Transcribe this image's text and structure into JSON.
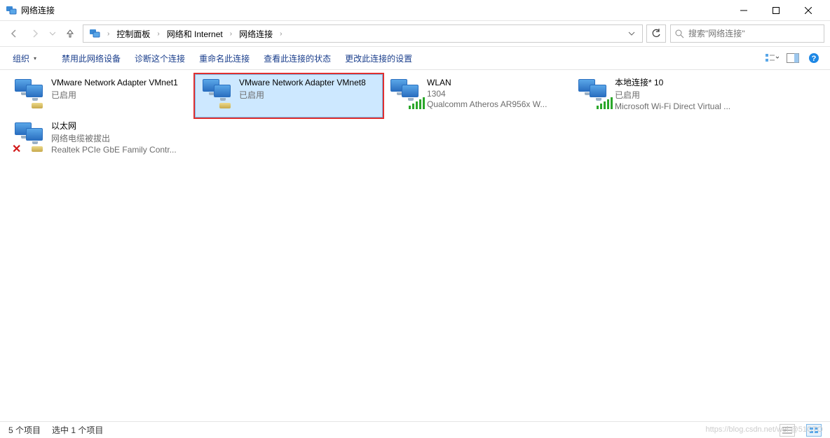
{
  "window": {
    "title": "网络连接"
  },
  "breadcrumb": {
    "items": [
      "控制面板",
      "网络和 Internet",
      "网络连接"
    ]
  },
  "search": {
    "placeholder": "搜索\"网络连接\""
  },
  "toolbar": {
    "organize": "组织",
    "disable": "禁用此网络设备",
    "diagnose": "诊断这个连接",
    "rename": "重命名此连接",
    "viewstatus": "查看此连接的状态",
    "changesettings": "更改此连接的设置"
  },
  "adapters": [
    {
      "name": "VMware Network Adapter VMnet1",
      "status": "已启用",
      "detail": "",
      "selected": false,
      "highlighted": false,
      "icontype": "vm"
    },
    {
      "name": "VMware Network Adapter VMnet8",
      "status": "已启用",
      "detail": "",
      "selected": true,
      "highlighted": true,
      "icontype": "vm"
    },
    {
      "name": "WLAN",
      "status": "1304",
      "detail": "Qualcomm Atheros AR956x W...",
      "selected": false,
      "highlighted": false,
      "icontype": "wifi"
    },
    {
      "name": "本地连接* 10",
      "status": "已启用",
      "detail": "Microsoft Wi-Fi Direct Virtual ...",
      "selected": false,
      "highlighted": false,
      "icontype": "wifi"
    },
    {
      "name": "以太网",
      "status": "网络电缆被拔出",
      "detail": "Realtek PCIe GbE Family Contr...",
      "selected": false,
      "highlighted": false,
      "icontype": "eth-unplugged"
    }
  ],
  "statusbar": {
    "count": "5 个项目",
    "selected": "选中 1 个项目"
  },
  "watermark": "https://blog.csdn.net/wei @51CTO"
}
